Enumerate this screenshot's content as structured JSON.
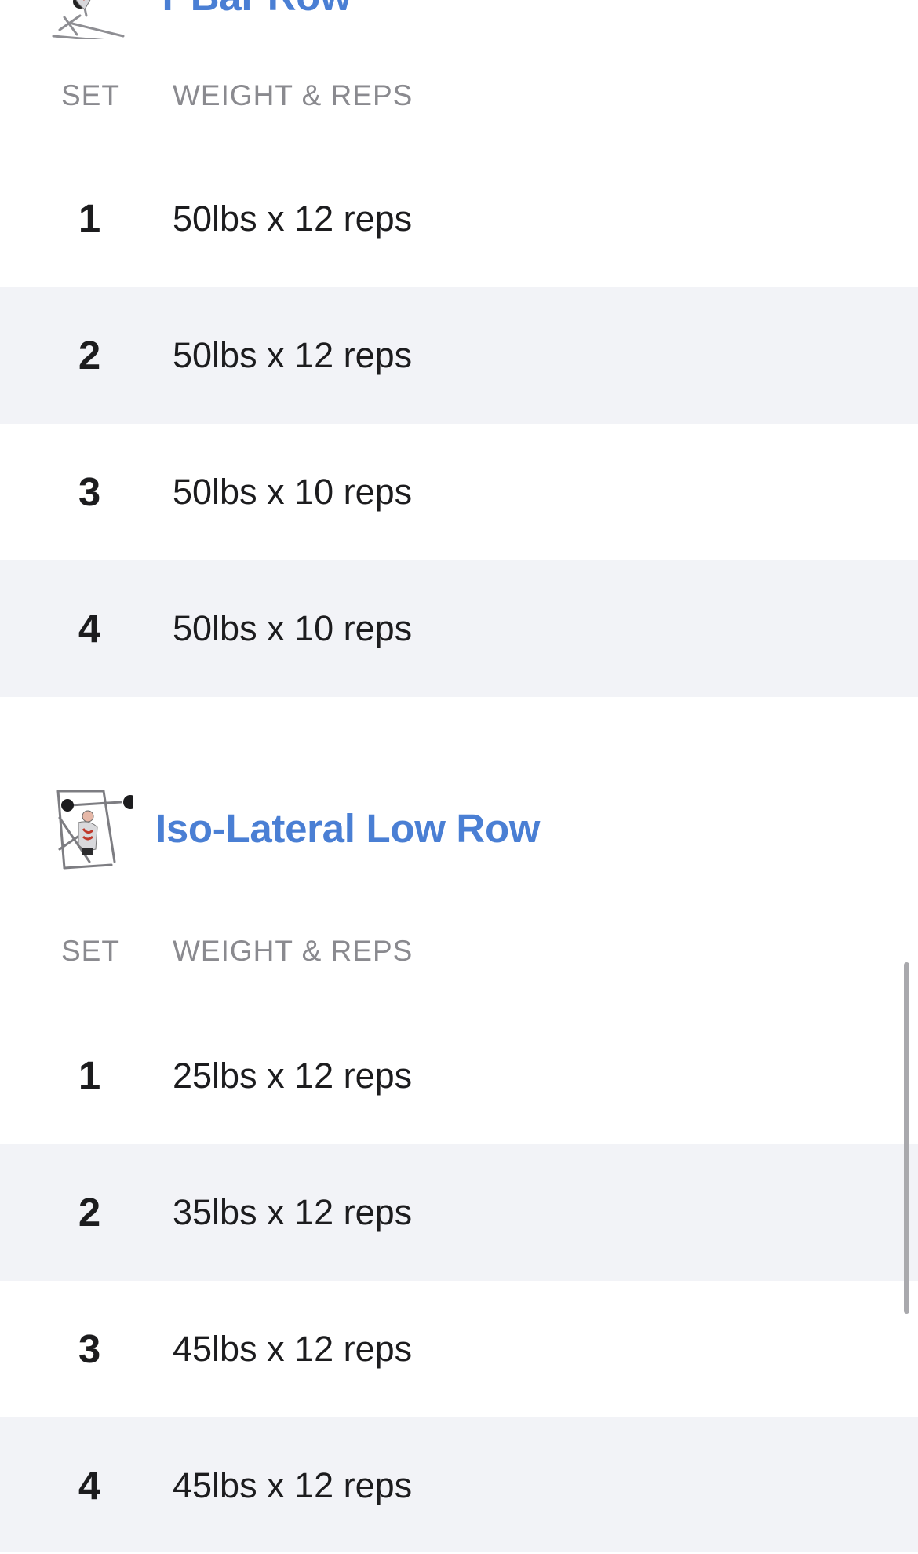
{
  "columns": {
    "set": "SET",
    "weight_reps": "WEIGHT & REPS"
  },
  "exercises": [
    {
      "title": "T Bar Row",
      "thumbnail_icon": "t-bar-row-illustration",
      "sets": [
        {
          "num": "1",
          "value": "50lbs x 12 reps"
        },
        {
          "num": "2",
          "value": "50lbs x 12 reps"
        },
        {
          "num": "3",
          "value": "50lbs x 10 reps"
        },
        {
          "num": "4",
          "value": "50lbs x 10 reps"
        }
      ]
    },
    {
      "title": "Iso-Lateral Low Row",
      "thumbnail_icon": "iso-lateral-low-row-illustration",
      "sets": [
        {
          "num": "1",
          "value": "25lbs x 12 reps"
        },
        {
          "num": "2",
          "value": "35lbs x 12 reps"
        },
        {
          "num": "3",
          "value": "45lbs x 12 reps"
        },
        {
          "num": "4",
          "value": "45lbs x 12 reps"
        }
      ]
    }
  ],
  "colors": {
    "title_accent": "#4a7fd4",
    "row_alt_background": "#f2f3f7",
    "column_header_text": "#8a8a8f"
  }
}
